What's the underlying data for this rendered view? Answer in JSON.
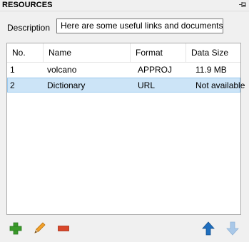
{
  "panel": {
    "title": "RESOURCES"
  },
  "description": {
    "label": "Description",
    "value": "Here are some useful links and documents:"
  },
  "table": {
    "columns": [
      "No.",
      "Name",
      "Format",
      "Data Size"
    ],
    "rows": [
      {
        "no": "1",
        "name": "volcano",
        "format": "APPROJ",
        "size": "11.9 MB",
        "selected": false
      },
      {
        "no": "2",
        "name": "Dictionary",
        "format": "URL",
        "size": "Not available",
        "selected": true
      }
    ]
  },
  "toolbar": {
    "icons": [
      "add-icon",
      "edit-icon",
      "remove-icon",
      "move-up-icon",
      "move-down-icon"
    ],
    "move_down_disabled": true
  },
  "colors": {
    "selection_bg": "#cce4f7",
    "add_green": "#3a9a2a",
    "remove_red": "#d9472b",
    "arrow_blue": "#1f6fbf"
  }
}
